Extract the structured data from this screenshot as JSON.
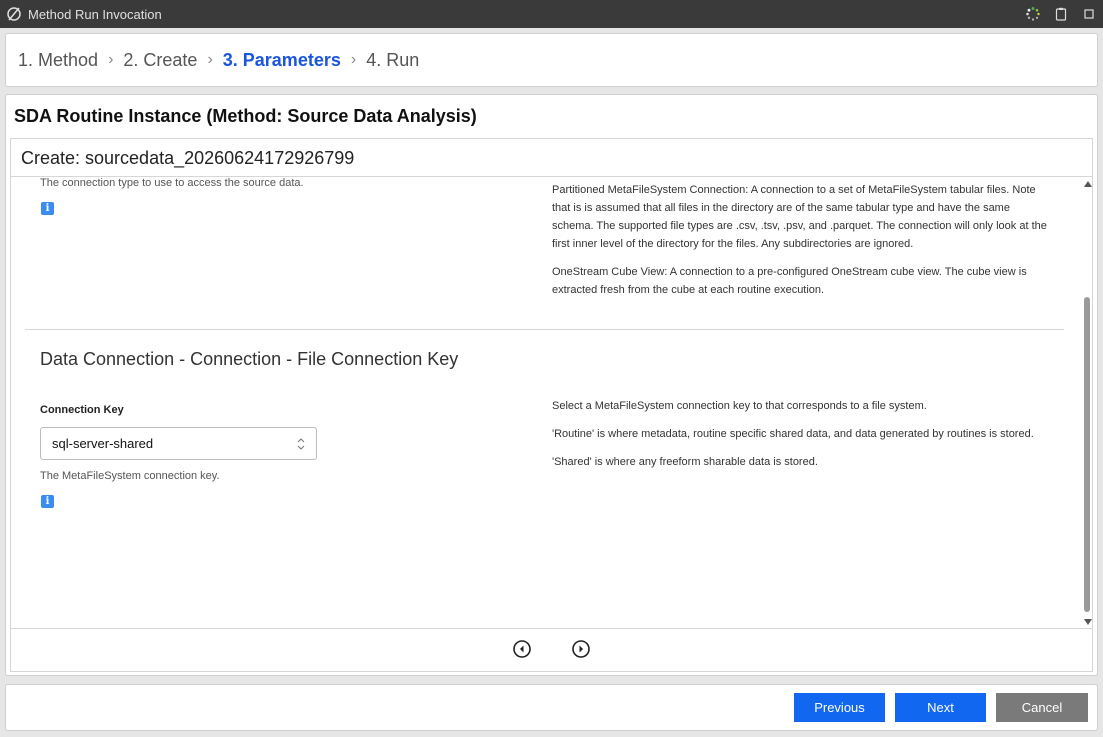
{
  "window": {
    "title": "Method Run Invocation"
  },
  "wizard": {
    "steps": [
      {
        "label": "1. Method",
        "active": false
      },
      {
        "label": "2. Create",
        "active": false
      },
      {
        "label": "3. Parameters",
        "active": true
      },
      {
        "label": "4. Run",
        "active": false
      }
    ],
    "separator": "›"
  },
  "panel": {
    "title": "SDA Routine Instance (Method: Source Data Analysis)",
    "create_title": "Create: sourcedata_20260624172926799"
  },
  "connection_type_section": {
    "help_text": "The connection type to use to access the source data.",
    "description": [
      "Partitioned MetaFileSystem Connection: A connection to a set of MetaFileSystem tabular files. Note that is is assumed that all files in the directory are of the same tabular type and have the same schema. The supported file types are .csv, .tsv, .psv, and .parquet. The connection will only look at the first inner level of the directory for the files. Any subdirectories are ignored.",
      "OneStream Cube View: A connection to a pre-configured OneStream cube view. The cube view is extracted fresh from the cube at each routine execution."
    ]
  },
  "file_connection_section": {
    "heading": "Data Connection - Connection - File Connection Key",
    "field_label": "Connection Key",
    "selected_value": "sql-server-shared",
    "help_text": "The MetaFileSystem connection key.",
    "description": [
      "Select a MetaFileSystem connection key to that corresponds to a file system.",
      "'Routine' is where metadata, routine specific shared data, and data generated by routines is stored.",
      "'Shared' is where any freeform sharable data is stored."
    ]
  },
  "footer": {
    "previous_label": "Previous",
    "next_label": "Next",
    "cancel_label": "Cancel"
  },
  "colors": {
    "accent": "#1267f0",
    "active_step": "#1a56db",
    "info_icon": "#3b8cf0",
    "titlebar": "#3a3a3a"
  }
}
